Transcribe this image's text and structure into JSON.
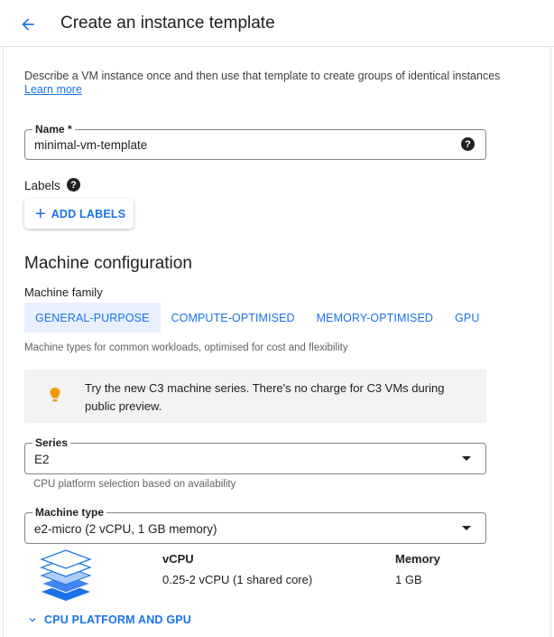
{
  "header": {
    "title": "Create an instance template",
    "back_icon": "arrow-back-icon"
  },
  "intro": {
    "description": "Describe a VM instance once and then use that template to create groups of identical instances",
    "learn_more": "Learn more"
  },
  "name_field": {
    "label": "Name *",
    "value": "minimal-vm-template",
    "help_icon": "?"
  },
  "labels": {
    "title": "Labels",
    "help_icon": "?",
    "add_button": "ADD LABELS",
    "add_icon": "+"
  },
  "machine_configuration": {
    "title": "Machine configuration",
    "family_label": "Machine family",
    "families": [
      {
        "label": "GENERAL-PURPOSE",
        "selected": true
      },
      {
        "label": "COMPUTE-OPTIMISED",
        "selected": false
      },
      {
        "label": "MEMORY-OPTIMISED",
        "selected": false
      },
      {
        "label": "GPU",
        "selected": false
      }
    ],
    "family_description": "Machine types for common workloads, optimised for cost and flexibility",
    "callout": {
      "icon": "lightbulb-icon",
      "text": "Try the new C3 machine series. There's no charge for C3 VMs during public preview."
    },
    "series": {
      "label": "Series",
      "value": "E2",
      "hint": "CPU platform selection based on availability"
    },
    "machine_type": {
      "label": "Machine type",
      "value": "e2-micro (2 vCPU, 1 GB memory)"
    },
    "specs": {
      "vcpu_header": "vCPU",
      "vcpu_value": "0.25-2 vCPU (1 shared core)",
      "memory_header": "Memory",
      "memory_value": "1 GB"
    },
    "cpu_platform_link": "CPU PLATFORM AND GPU"
  },
  "colors": {
    "accent": "#1a73e8",
    "selected_tab_bg": "#e8f0fe",
    "callout_bg": "#f1f3f4",
    "bulb": "#f29900"
  }
}
